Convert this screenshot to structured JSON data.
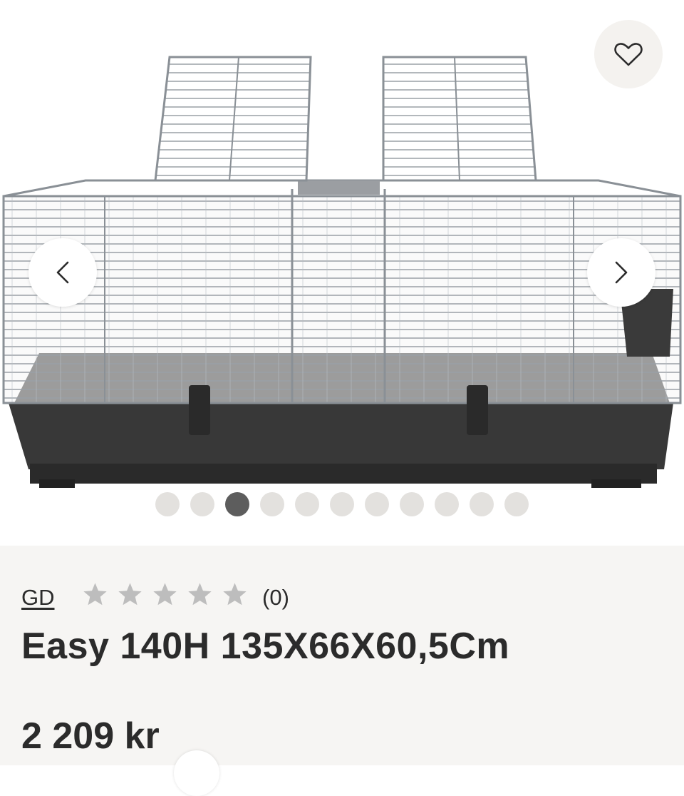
{
  "gallery": {
    "product_image": "rabbit-cage-image",
    "total_images": 11,
    "active_index": 2,
    "favorite_icon": "heart-outline-icon",
    "prev_icon": "chevron-left-icon",
    "next_icon": "chevron-right-icon"
  },
  "product": {
    "brand": "GD",
    "rating_stars": 0,
    "rating_count": "(0)",
    "title": "Easy 140H 135X66X60,5Cm",
    "price": "2 209 kr"
  },
  "colors": {
    "dot_inactive": "#e3e1de",
    "dot_active": "#5d5d5d",
    "info_bg": "#f6f5f3",
    "star_empty": "#bdbdbd",
    "text": "#2b2b2b"
  }
}
